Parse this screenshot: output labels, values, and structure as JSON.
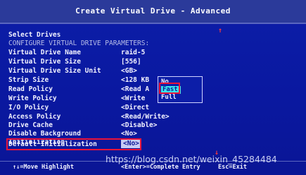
{
  "title": "Create Virtual Drive - Advanced",
  "select_drives_label": "Select Drives",
  "configure_params_label": "CONFIGURE VIRTUAL DRIVE PARAMETERS:",
  "params": [
    {
      "label": "Virtual Drive Name",
      "value": "raid-5"
    },
    {
      "label": "Virtual Drive Size",
      "value": "[556]"
    },
    {
      "label": "Virtual Drive Size Unit",
      "value": "<GB>"
    },
    {
      "label": "Strip Size",
      "value": "<128 KB"
    },
    {
      "label": "Read Policy",
      "value": "<Read A"
    },
    {
      "label": "Write Policy",
      "value": "<Write"
    },
    {
      "label": "I/O Policy",
      "value": "<Direct"
    },
    {
      "label": "Access Policy",
      "value": "<Read/Write>"
    },
    {
      "label": "Drive Cache",
      "value": "<Disable>"
    },
    {
      "label": "Disable Background",
      "value": "<No>"
    },
    {
      "label": "Initialization",
      "value": ""
    },
    {
      "label": "Default Initialization",
      "value": "<No>"
    }
  ],
  "popup_options": [
    "No",
    "Fast",
    "Full"
  ],
  "popup_selected": "Fast",
  "footer": {
    "nav": "↑↓=Move Highlight",
    "enter": "<Enter>=Complete Entry",
    "esc": "Esc=Exit"
  },
  "watermark": "https://blog.csdn.net/weixin_45284484",
  "colors": {
    "background": "#0a18a0",
    "highlight": "#39e6ee",
    "annotation": "#e8133a",
    "arrow": "#ff3a3a"
  }
}
